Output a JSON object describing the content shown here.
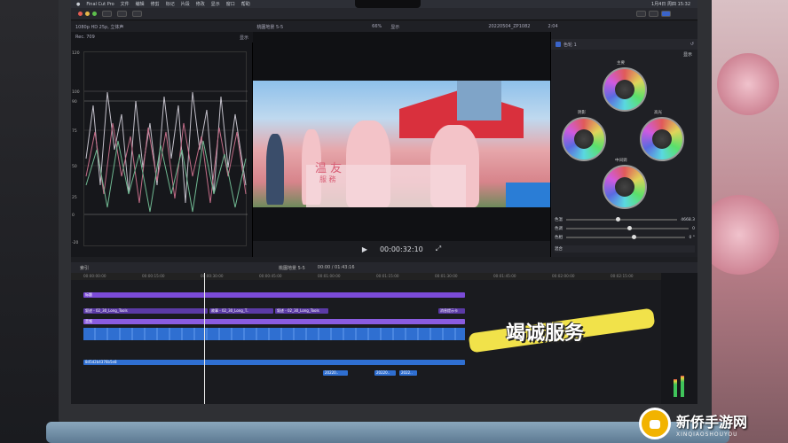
{
  "app": {
    "menu": [
      "Final Cut Pro",
      "文件",
      "编辑",
      "修剪",
      "标记",
      "片段",
      "修改",
      "显示",
      "窗口",
      "帮助"
    ],
    "menubar_right": "1月4日 周四 15:32"
  },
  "toolbar": {
    "format": "1080p HD 25p, 立体声"
  },
  "scope": {
    "title": "Rec. 709",
    "display_menu": "显示",
    "ticks": [
      "120",
      "100",
      "90",
      "75",
      "50",
      "25",
      "0",
      "-20"
    ]
  },
  "viewer": {
    "title": "桃園地景 5-5",
    "zoom": "66%",
    "display_menu": "显示",
    "timecode": "00:00:32:10",
    "frame_text": "温 友",
    "frame_text2": "服 務"
  },
  "inspector": {
    "clip_name": "20220504_ZP1082",
    "duration": "2:04",
    "effect": "色轮 1",
    "display_menu": "显示",
    "wheels": [
      "主要",
      "阴影",
      "高光",
      "中间调"
    ],
    "sliders": [
      {
        "label": "色温",
        "value": "4668.3",
        "pos": 0.45
      },
      {
        "label": "色调",
        "value": "0",
        "pos": 0.5
      },
      {
        "label": "色相",
        "value": "0 °",
        "pos": 0.55
      }
    ],
    "mix_label": "混合"
  },
  "timeline": {
    "index_label": "索引",
    "project": "桃園地景 5-5",
    "duration": "00:00 / 01:43:16",
    "ruler": [
      "00:00:00:00",
      "00:00:15:00",
      "00:00:30:00",
      "00:00:45:00",
      "00:01:00:00",
      "00:01:15:00",
      "00:01:30:00",
      "00:01:45:00",
      "00:02:00:00",
      "00:02:15:00",
      "00:02:30:00"
    ],
    "title_clip": "标题",
    "music_clip": "8d5d2b4376b5e8",
    "lower_clips": [
      "20220..",
      "20220..",
      "2022.."
    ],
    "audio_label": "音频",
    "story_clip": "叙述 - 02_30_Long_Tools",
    "story_clip2": "故事 - 02_30_Long_T..",
    "story_clip3": "叙述 - 02_30_Long_Tools",
    "story_end": "叙述 - 02_30_Long_T..",
    "badge_clip": "消息提示卡"
  },
  "overlay": {
    "banner": "竭诚服务"
  },
  "watermark": {
    "title": "新侨手游网",
    "subtitle": "XINQIAOSHOUYOU"
  },
  "colors": {
    "purple": "#7b4bd8",
    "blue": "#2f6fd1",
    "accent_yellow": "#f1e24a"
  }
}
